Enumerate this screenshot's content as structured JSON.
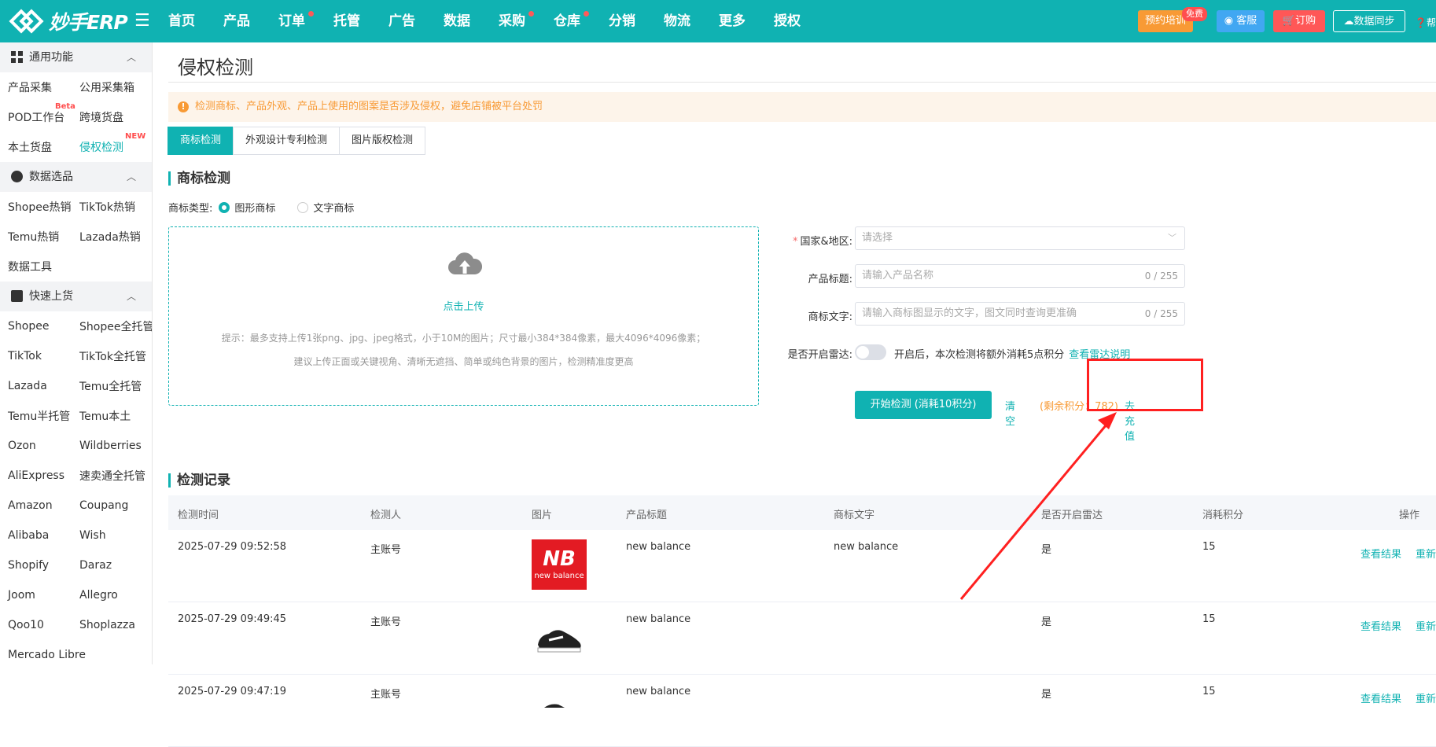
{
  "topbar": {
    "logo_text": "妙手ERP",
    "nav": [
      "首页",
      "产品",
      "订单",
      "托管",
      "广告",
      "数据",
      "采购",
      "仓库",
      "分销",
      "物流",
      "更多",
      "授权"
    ],
    "train_label": "预约培训",
    "free_badge": "免费",
    "service_label": "客服",
    "order_label": "订购",
    "sync_label": "数据同步",
    "help_label": "帮"
  },
  "sidebar": {
    "groups": [
      {
        "title": "通用功能",
        "rows": [
          [
            "产品采集",
            "公用采集箱"
          ],
          [
            "POD工作台",
            "跨境货盘"
          ],
          [
            "本土货盘",
            "侵权检测"
          ]
        ]
      },
      {
        "title": "数据选品",
        "rows": [
          [
            "Shopee热销",
            "TikTok热销"
          ],
          [
            "Temu热销",
            "Lazada热销"
          ],
          [
            "数据工具",
            ""
          ]
        ]
      },
      {
        "title": "快速上货",
        "rows": [
          [
            "Shopee",
            "Shopee全托管"
          ],
          [
            "TikTok",
            "TikTok全托管"
          ],
          [
            "Lazada",
            "Temu全托管"
          ],
          [
            "Temu半托管",
            "Temu本土"
          ],
          [
            "Ozon",
            "Wildberries"
          ],
          [
            "AliExpress",
            "速卖通全托管"
          ],
          [
            "Amazon",
            "Coupang"
          ],
          [
            "Alibaba",
            "Wish"
          ],
          [
            "Shopify",
            "Daraz"
          ],
          [
            "Joom",
            "Allegro"
          ],
          [
            "Qoo10",
            "Shoplazza"
          ],
          [
            "Mercado Libre",
            ""
          ]
        ]
      }
    ],
    "pod_badge": "Beta",
    "new_badge": "NEW"
  },
  "page": {
    "title": "侵权检测",
    "alert": "检测商标、产品外观、产品上使用的图案是否涉及侵权，避免店铺被平台处罚",
    "tabs": [
      "商标检测",
      "外观设计专利检测",
      "图片版权检测"
    ],
    "section_trademark": "商标检测",
    "type_label": "商标类型:",
    "type_options": [
      "图形商标",
      "文字商标"
    ],
    "upload_link": "点击上传",
    "upload_tip1": "提示：最多支持上传1张png、jpg、jpeg格式，小于10M的图片；尺寸最小384*384像素，最大4096*4096像素；",
    "upload_tip2": "建议上传正面或关键视角、清晰无遮挡、简单或纯色背景的图片，检测精准度更高"
  },
  "form": {
    "country_label": "国家&地区:",
    "country_placeholder": "请选择",
    "title_label": "产品标题:",
    "title_placeholder": "请输入产品名称",
    "title_count": "0 / 255",
    "text_label": "商标文字:",
    "text_placeholder": "请输入商标图显示的文字，图文同时查询更准确",
    "text_count": "0 / 255",
    "radar_label": "是否开启雷达:",
    "radar_note": "开启后，本次检测将额外消耗5点积分",
    "radar_link": "查看雷达说明",
    "start_button": "开始检测 (消耗10积分)",
    "clear_button": "清空",
    "remain_text": "(剩余积分：782)",
    "recharge_link": "去充值"
  },
  "records": {
    "title": "检测记录",
    "headers": [
      "检测时间",
      "检测人",
      "图片",
      "产品标题",
      "商标文字",
      "是否开启雷达",
      "消耗积分",
      "操作"
    ],
    "rows": [
      {
        "time": "2025-07-29 09:52:58",
        "user": "主账号",
        "product": "new balance",
        "mark_text": "new balance",
        "radar": "是",
        "points": "15",
        "image": "nb-logo-image"
      },
      {
        "time": "2025-07-29 09:49:45",
        "user": "主账号",
        "product": "new balance",
        "mark_text": "",
        "radar": "是",
        "points": "15",
        "image": "shoe-image"
      },
      {
        "time": "2025-07-29 09:47:19",
        "user": "主账号",
        "product": "new balance",
        "mark_text": "",
        "radar": "是",
        "points": "15",
        "image": "shoe-image"
      }
    ],
    "op_view": "查看结果",
    "op_redo": "重新",
    "nb_logo_text": "NB",
    "nb_logo_sub": "new balance"
  }
}
